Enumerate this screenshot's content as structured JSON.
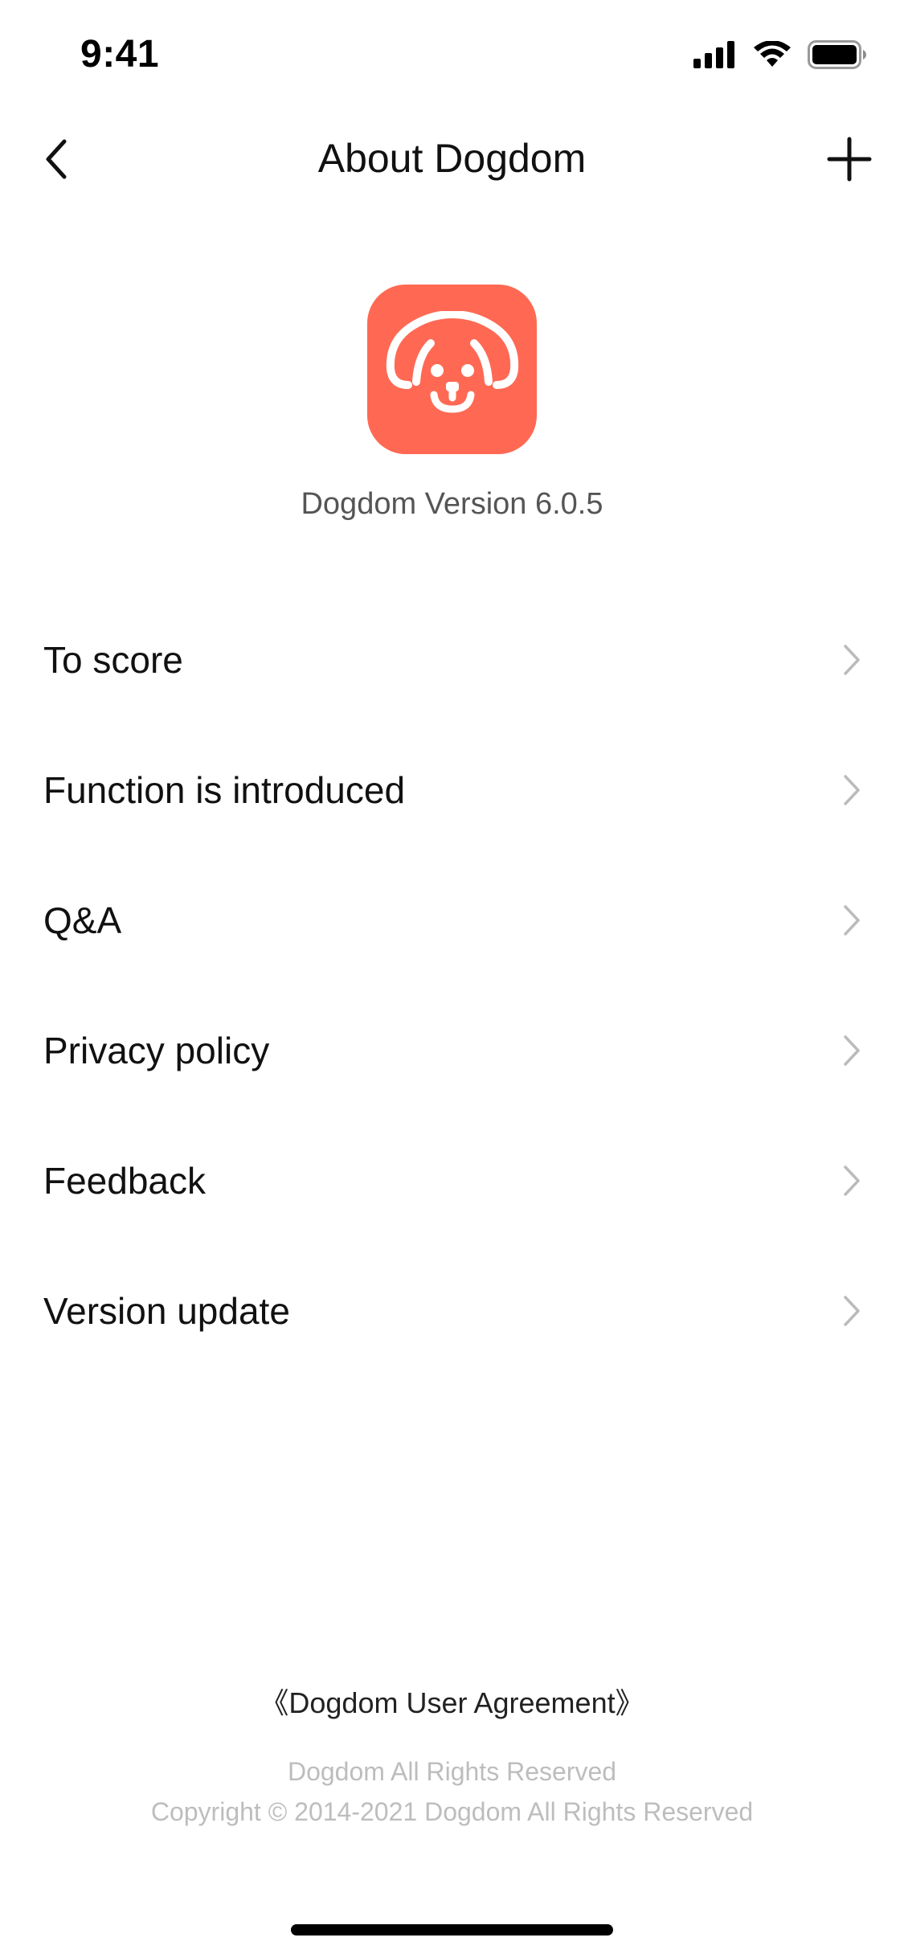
{
  "status_bar": {
    "time": "9:41"
  },
  "nav": {
    "title": "About Dogdom",
    "back_icon": "chevron-left-icon",
    "add_icon": "plus-icon"
  },
  "app": {
    "logo_icon": "dog-face-icon",
    "version_text": "Dogdom Version 6.0.5",
    "brand_color": "#FF6954"
  },
  "menu": {
    "items": [
      {
        "label": "To score"
      },
      {
        "label": "Function is introduced"
      },
      {
        "label": "Q&A"
      },
      {
        "label": "Privacy policy"
      },
      {
        "label": "Feedback"
      },
      {
        "label": "Version update"
      }
    ],
    "chevron_icon": "chevron-right-icon"
  },
  "footer": {
    "agreement": "《Dogdom User Agreement》",
    "rights": "Dogdom All Rights Reserved",
    "copyright": "Copyright © 2014-2021 Dogdom All Rights Reserved"
  }
}
